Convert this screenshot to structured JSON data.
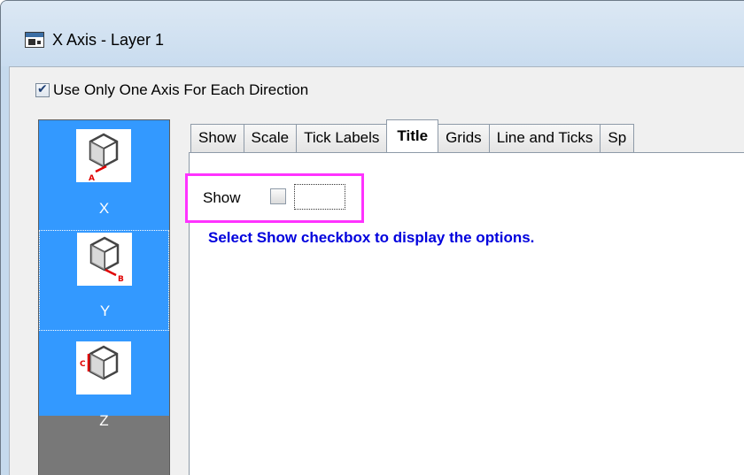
{
  "window": {
    "title": "X Axis - Layer 1"
  },
  "options": {
    "one_axis_label": "Use Only One Axis For Each Direction",
    "one_axis_checked": true
  },
  "axis_list": {
    "items": [
      {
        "label": "X",
        "badge": "A"
      },
      {
        "label": "Y",
        "badge": "B"
      },
      {
        "label": "Z",
        "badge": "C"
      }
    ]
  },
  "tabs": [
    {
      "label": "Show"
    },
    {
      "label": "Scale"
    },
    {
      "label": "Tick Labels"
    },
    {
      "label": "Title"
    },
    {
      "label": "Grids"
    },
    {
      "label": "Line and Ticks"
    },
    {
      "label": "Sp"
    }
  ],
  "active_tab": "Title",
  "title_page": {
    "show_label": "Show",
    "show_checked": false,
    "hint": "Select Show checkbox to display the options."
  },
  "colors": {
    "selection_blue": "#3399ff",
    "highlight_magenta": "#ff33ff",
    "hint_blue": "#0000dd"
  }
}
